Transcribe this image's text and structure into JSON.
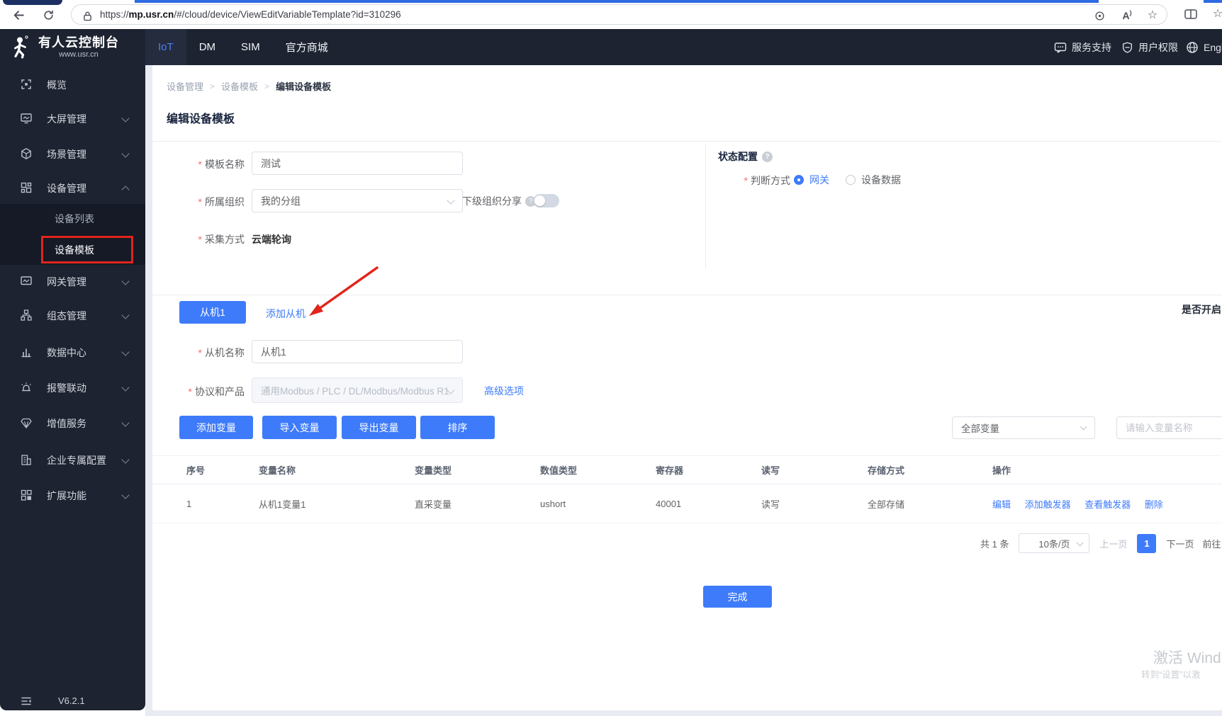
{
  "ui": {
    "breadcrumb_separator": ">",
    "help_glyph": "?",
    "required_mark": "*"
  },
  "browser": {
    "url_scheme": "https://",
    "url_domain": "mp.usr.cn",
    "url_path": "/#/cloud/device/ViewEditVariableTemplate?id=310296"
  },
  "header": {
    "logo_title": "有人云控制台",
    "logo_subtitle": "www.usr.cn",
    "nav_iot": "IoT",
    "nav_dm": "DM",
    "nav_sim": "SIM",
    "nav_mall": "官方商城",
    "support": "服务支持",
    "permission": "用户权限",
    "language": "English"
  },
  "sidebar": {
    "overview": "概览",
    "screen": "大屏管理",
    "scene": "场景管理",
    "device": "设备管理",
    "device_list": "设备列表",
    "device_template": "设备模板",
    "gateway": "网关管理",
    "configuration": "组态管理",
    "data_center": "数据中心",
    "alarm": "报警联动",
    "value_added": "增值服务",
    "enterprise": "企业专属配置",
    "extension": "扩展功能",
    "version": "V6.2.1"
  },
  "breadcrumb": {
    "level1": "设备管理",
    "level2": "设备模板",
    "level3": "编辑设备模板"
  },
  "page": {
    "title": "编辑设备模板"
  },
  "form": {
    "template_name_label": "模板名称",
    "template_name_value": "测试",
    "org_label": "所属组织",
    "org_value": "我的分组",
    "share_label": "下级组织分享",
    "collect_label": "采集方式",
    "collect_value": "云端轮询",
    "status_title": "状态配置",
    "judge_label": "判断方式",
    "judge_option1": "网关",
    "judge_option2": "设备数据"
  },
  "slave": {
    "tab_label": "从机1",
    "add_slave": "添加从机",
    "right_hint": "是否开启",
    "name_label": "从机名称",
    "name_value": "从机1",
    "protocol_label": "协议和产品",
    "protocol_value": "通用Modbus / PLC / DL/Modbus/Modbus R1",
    "advanced": "高级选项",
    "btn_add": "添加变量",
    "btn_import": "导入变量",
    "btn_export": "导出变量",
    "btn_sort": "排序",
    "filter_all": "全部变量",
    "filter_placeholder": "请输入变量名称"
  },
  "table": {
    "headers": [
      "序号",
      "变量名称",
      "变量类型",
      "数值类型",
      "寄存器",
      "读写",
      "存储方式",
      "操作"
    ],
    "rows": [
      {
        "index": "1",
        "name": "从机1变量1",
        "var_type": "直采变量",
        "value_type": "ushort",
        "register": "40001",
        "rw": "读写",
        "storage": "全部存储",
        "action_edit": "编辑",
        "action_add_trigger": "添加触发器",
        "action_view_trigger": "查看触发器",
        "action_delete": "删除"
      }
    ]
  },
  "pagination": {
    "total": "共 1 条",
    "page_size": "10条/页",
    "prev": "上一页",
    "current": "1",
    "next": "下一页",
    "goto": "前往"
  },
  "footer": {
    "done": "完成"
  },
  "watermark": {
    "line1": "激活 Wind",
    "line2": "转到“设置”以激"
  },
  "colors": {
    "accent": "#3e7bfa",
    "annotation": "#e1251b",
    "dark": "#1d2330"
  }
}
